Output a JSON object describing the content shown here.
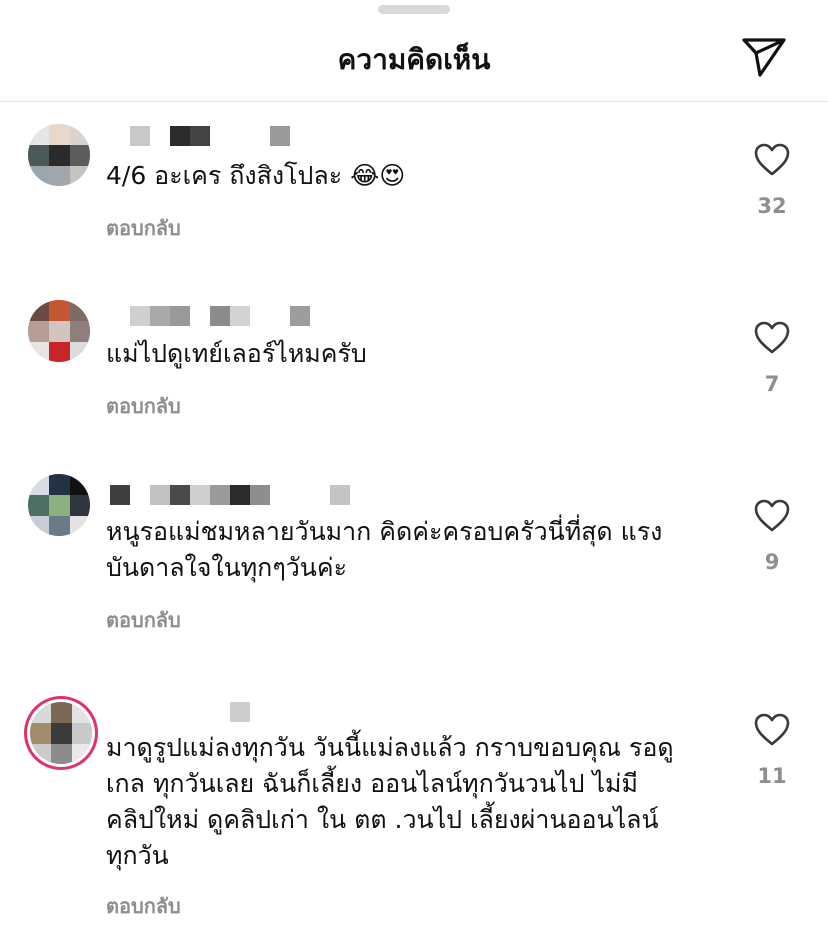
{
  "header": {
    "title": "ความคิดเห็น"
  },
  "comments": [
    {
      "text": "4/6 อะเคร ถึงสิงโปละ 😂😍",
      "reply_label": "ตอบกลับ",
      "likes": "32"
    },
    {
      "text": "แม่ไปดูเทย์เลอร์ไหมครับ",
      "reply_label": "ตอบกลับ",
      "likes": "7"
    },
    {
      "text": "หนูรอแม่ชมหลายวันมาก คิดค่ะครอบครัวนี่ที่สุด แรง\nบันดาลใจในทุกๆวันค่ะ",
      "reply_label": "ตอบกลับ",
      "likes": "9"
    },
    {
      "text": "มาดูรูปแม่ลงทุกวัน วันนี้แม่ลงแล้ว กราบขอบคุณ รอดู\nเกล ทุกวันเลย ฉันก็เลี้ยง ออนไลน์ทุกวันวนไป ไม่มี\nคลิปใหม่ ดูคลิปเก่า ใน ตต .วนไป เลี้ยงผ่านออนไลน์\nทุกวัน",
      "reply_label": "ตอบกลับ",
      "likes": "11"
    }
  ]
}
